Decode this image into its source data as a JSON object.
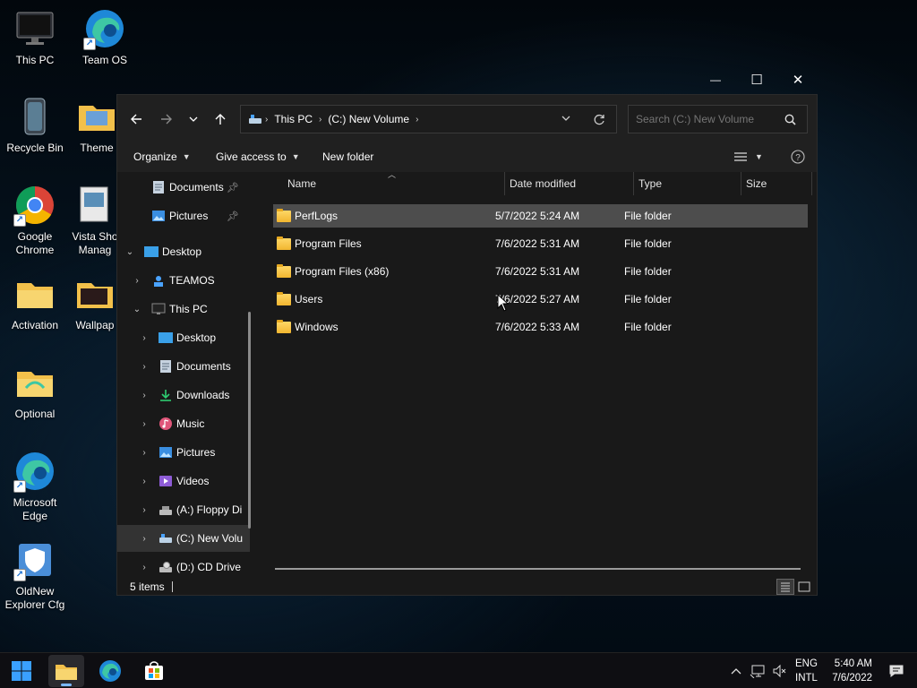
{
  "desktop_icons": [
    {
      "id": "this-pc",
      "label": "This PC"
    },
    {
      "id": "team-os",
      "label": "Team OS"
    },
    {
      "id": "recycle-bin",
      "label": "Recycle Bin"
    },
    {
      "id": "themes",
      "label": "Theme"
    },
    {
      "id": "google-chrome",
      "label": "Google Chrome"
    },
    {
      "id": "vista-shortcut",
      "label": "Vista Sho Manag"
    },
    {
      "id": "activation",
      "label": "Activation"
    },
    {
      "id": "wallpapers",
      "label": "Wallpap"
    },
    {
      "id": "optional",
      "label": "Optional"
    },
    {
      "id": "microsoft-edge",
      "label": "Microsoft Edge"
    },
    {
      "id": "oldnew-explorer",
      "label": "OldNew Explorer Cfg"
    }
  ],
  "window": {
    "controls": {
      "minimize": "—",
      "maximize": "☐",
      "close": "✕"
    }
  },
  "address": {
    "segments": [
      "This PC",
      "(C:) New Volume"
    ]
  },
  "search": {
    "placeholder": "Search (C:) New Volume"
  },
  "commands": {
    "organize": "Organize",
    "give_access": "Give access to",
    "new_folder": "New folder"
  },
  "nav": {
    "items": [
      {
        "label": "Documents",
        "pinned": true
      },
      {
        "label": "Pictures",
        "pinned": true
      },
      {
        "label": "Desktop"
      },
      {
        "label": "TEAMOS"
      },
      {
        "label": "This PC"
      },
      {
        "label": "Desktop"
      },
      {
        "label": "Documents"
      },
      {
        "label": "Downloads"
      },
      {
        "label": "Music"
      },
      {
        "label": "Pictures"
      },
      {
        "label": "Videos"
      },
      {
        "label": "(A:) Floppy Di"
      },
      {
        "label": "(C:) New Volu"
      },
      {
        "label": "(D:) CD Drive"
      }
    ]
  },
  "columns": {
    "name": "Name",
    "date": "Date modified",
    "type": "Type",
    "size": "Size"
  },
  "files": [
    {
      "name": "PerfLogs",
      "date": "5/7/2022 5:24 AM",
      "type": "File folder"
    },
    {
      "name": "Program Files",
      "date": "7/6/2022 5:31 AM",
      "type": "File folder"
    },
    {
      "name": "Program Files (x86)",
      "date": "7/6/2022 5:31 AM",
      "type": "File folder"
    },
    {
      "name": "Users",
      "date": "7/6/2022 5:27 AM",
      "type": "File folder"
    },
    {
      "name": "Windows",
      "date": "7/6/2022 5:33 AM",
      "type": "File folder"
    }
  ],
  "status": {
    "items": "5 items"
  },
  "taskbar": {
    "lang": "ENG",
    "layout": "INTL",
    "time": "5:40 AM",
    "date": "7/6/2022"
  },
  "colors": {
    "accent": "#0078d4",
    "folder": "#f2b630"
  }
}
